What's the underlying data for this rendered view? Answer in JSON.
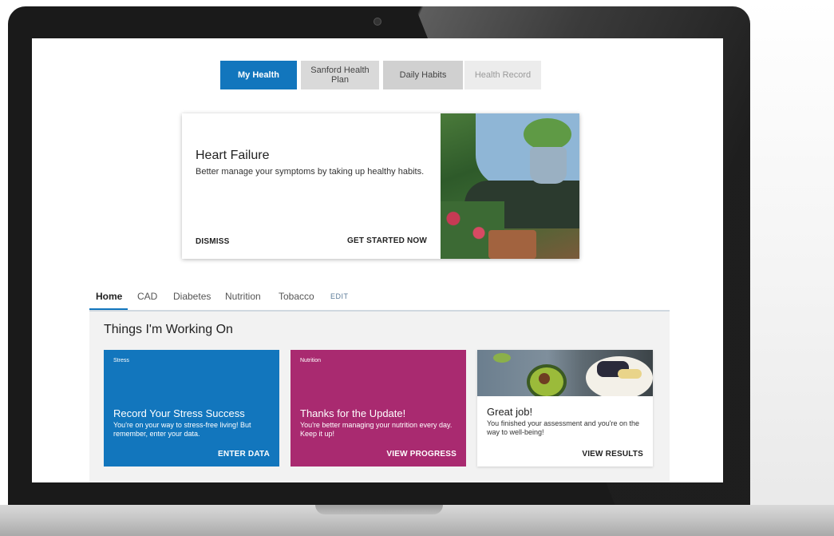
{
  "colors": {
    "primary_blue": "#1276bd",
    "nutrition_magenta": "#a92a70",
    "panel_bg": "#f2f2f2"
  },
  "segmented_tabs": [
    {
      "label": "My Health",
      "active": true
    },
    {
      "label": "Sanford Health Plan",
      "active": false
    },
    {
      "label": "Daily Habits",
      "active": false
    },
    {
      "label": "Health Record",
      "active": false
    }
  ],
  "hero": {
    "title": "Heart Failure",
    "description": "Better manage your symptoms by taking up healthy habits.",
    "dismiss_label": "DISMISS",
    "cta_label": "GET STARTED NOW",
    "image": "woman-gardening-photo"
  },
  "subtabs": [
    {
      "label": "Home",
      "active": true
    },
    {
      "label": "CAD",
      "active": false
    },
    {
      "label": "Diabetes",
      "active": false
    },
    {
      "label": "Nutrition",
      "active": false
    },
    {
      "label": "Tobacco",
      "active": false
    }
  ],
  "subtabs_edit_label": "EDIT",
  "working_on": {
    "title": "Things I'm Working On",
    "cards": [
      {
        "tag": "Stress",
        "title": "Record Your Stress Success",
        "description": "You're on your way to stress-free living! But remember, enter your data.",
        "cta": "ENTER DATA"
      },
      {
        "tag": "Nutrition",
        "title": "Thanks for the Update!",
        "description": "You're better managing your nutrition every day. Keep it up!",
        "cta": "VIEW PROGRESS"
      },
      {
        "tag": "",
        "title": "Great job!",
        "description": "You finished your assessment and you're on the way to well-being!",
        "cta": "VIEW RESULTS",
        "image": "healthy-food-photo"
      }
    ]
  }
}
